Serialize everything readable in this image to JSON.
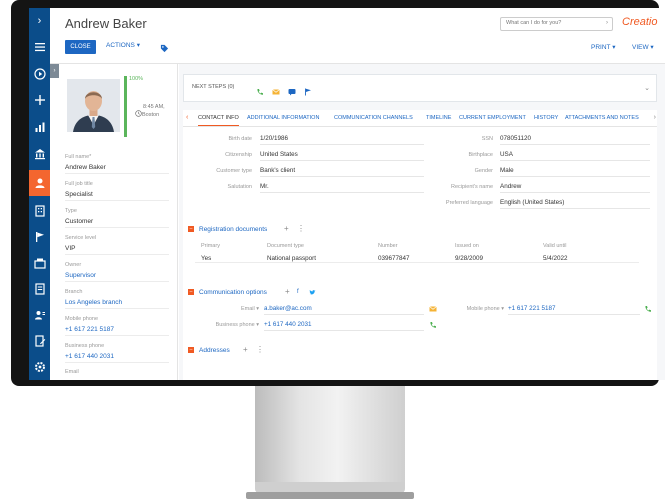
{
  "page": {
    "title": "Andrew Baker"
  },
  "header": {
    "close_label": "CLOSE",
    "actions_label": "ACTIONS ▾",
    "search_placeholder": "What can I do for you?",
    "logo": "Creatio",
    "print_label": "PRINT ▾",
    "view_label": "VIEW ▾"
  },
  "profile": {
    "fill_pct": "100%",
    "fill_fraction": 1.0,
    "time": "8:45 AM,",
    "city": "Boston",
    "fields": [
      {
        "label": "Full name*",
        "value": "Andrew Baker",
        "link": false
      },
      {
        "label": "Full job title",
        "value": "Specialist",
        "link": false
      },
      {
        "label": "Type",
        "value": "Customer",
        "link": false
      },
      {
        "label": "Service level",
        "value": "VIP",
        "link": false
      },
      {
        "label": "Owner",
        "value": "Supervisor",
        "link": true
      },
      {
        "label": "Branch",
        "value": "Los Angeles branch",
        "link": true
      },
      {
        "label": "Mobile phone",
        "value": "+1 617 221 5187",
        "link": true
      },
      {
        "label": "Business phone",
        "value": "+1 617 440 2031",
        "link": true
      },
      {
        "label": "Email",
        "value": "",
        "link": false
      }
    ]
  },
  "next_steps": {
    "label": "NEXT STEPS (0)"
  },
  "tabs": [
    "CONTACT INFO",
    "ADDITIONAL INFORMATION",
    "COMMUNICATION CHANNELS",
    "TIMELINE",
    "CURRENT EMPLOYMENT",
    "HISTORY",
    "ATTACHMENTS AND NOTES"
  ],
  "contact_info": {
    "left": [
      {
        "label": "Birth date",
        "value": "1/20/1986"
      },
      {
        "label": "Citizenship",
        "value": "United States"
      },
      {
        "label": "Customer type",
        "value": "Bank's client"
      },
      {
        "label": "Salutation",
        "value": "Mr."
      }
    ],
    "right": [
      {
        "label": "SSN",
        "value": "078051120"
      },
      {
        "label": "Birthplace",
        "value": "USA"
      },
      {
        "label": "Gender",
        "value": "Male"
      },
      {
        "label": "Recipient's name",
        "value": "Andrew"
      },
      {
        "label": "Preferred language",
        "value": "English (United States)"
      }
    ]
  },
  "registration": {
    "title": "Registration documents",
    "columns": [
      "Primary",
      "Document type",
      "Number",
      "Issued on",
      "Valid until"
    ],
    "rows": [
      [
        "Yes",
        "National passport",
        "039677847",
        "9/28/2009",
        "5/4/2022"
      ]
    ]
  },
  "communication": {
    "title": "Communication options",
    "fields": [
      {
        "label": "Email ▾",
        "value": "a.baker@ac.com"
      },
      {
        "label": "Business phone ▾",
        "value": "+1 617 440 2031"
      },
      {
        "label": "Mobile phone ▾",
        "value": "+1 617 221 5187"
      }
    ]
  },
  "addresses": {
    "title": "Addresses"
  },
  "colors": {
    "nav": "#0b4d8a",
    "accent": "#f05a23",
    "link": "#1d67c2",
    "close": "#1d67c2"
  }
}
